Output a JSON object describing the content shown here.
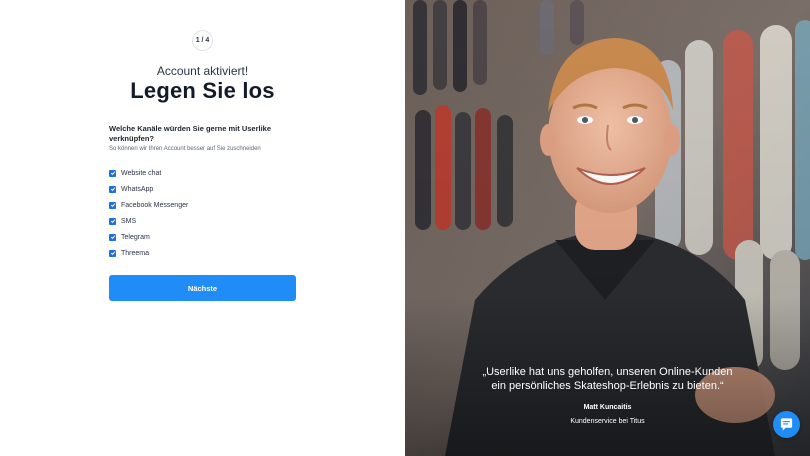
{
  "onboarding": {
    "step_indicator": "1 / 4",
    "subtitle": "Account aktiviert!",
    "title": "Legen Sie los",
    "question": "Welche Kanäle würden Sie gerne mit Userlike verknüpfen?",
    "hint": "So können wir Ihren Account besser auf Sie zuschneiden",
    "channels": [
      {
        "label": "Website chat",
        "checked": true
      },
      {
        "label": "WhatsApp",
        "checked": true
      },
      {
        "label": "Facebook Messenger",
        "checked": true
      },
      {
        "label": "SMS",
        "checked": true
      },
      {
        "label": "Telegram",
        "checked": true
      },
      {
        "label": "Threema",
        "checked": true
      }
    ],
    "next_label": "Nächste"
  },
  "testimonial": {
    "quote_line1": "„Userlike hat uns geholfen, unseren Online-Kunden",
    "quote_line2": "ein persönliches Skateshop-Erlebnis zu bieten.“",
    "author": "Matt Kuncaitis",
    "role": "Kundenservice bei Titus"
  },
  "colors": {
    "accent": "#1f8df5",
    "checkbox": "#1f6fe0",
    "title_text": "#141a27"
  },
  "icons": {
    "chat_widget": "chat-bubble-icon",
    "checkbox": "checkmark-icon"
  }
}
